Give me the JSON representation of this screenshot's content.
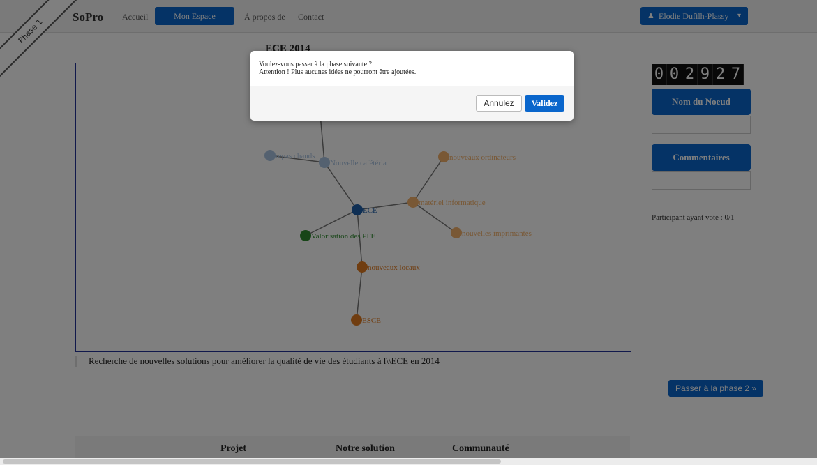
{
  "nav": {
    "brand": "SoPro",
    "links": [
      "Accueil",
      "Mon Espace",
      "À propos de",
      "Contact"
    ],
    "user": "Elodie Dufilh-Plassy",
    "user_icon": "user-icon",
    "caret_icon": "caret-down-icon",
    "accent": "#0a66cc"
  },
  "ribbon": "Phase 1",
  "title": "ECE 2014",
  "graph": {
    "nodes": [
      {
        "id": "ece",
        "label": "ECE",
        "color": "#1f5fa8"
      },
      {
        "id": "cafet",
        "label": "Nouvelle cafétéria",
        "color": "#a9c3e0"
      },
      {
        "id": "repas",
        "label": "repas chauds",
        "color": "#a9c3e0"
      },
      {
        "id": "pfe",
        "label": "Valorisation des PFE",
        "color": "#2e8b2e"
      },
      {
        "id": "materiel",
        "label": "matériel informatique",
        "color": "#f2b06a"
      },
      {
        "id": "ordis",
        "label": "nouveaux ordinateurs",
        "color": "#f2b06a"
      },
      {
        "id": "imprimantes",
        "label": "nouvelles imprimantes",
        "color": "#f2b06a"
      },
      {
        "id": "locaux",
        "label": "nouveaux locaux",
        "color": "#e07b20"
      },
      {
        "id": "esce",
        "label": "ESCE",
        "color": "#e07b20"
      }
    ],
    "edges": [
      [
        "ece",
        "cafet"
      ],
      [
        "cafet",
        "repas"
      ],
      [
        "cafet",
        "top"
      ],
      [
        "ece",
        "pfe"
      ],
      [
        "ece",
        "materiel"
      ],
      [
        "materiel",
        "ordis"
      ],
      [
        "materiel",
        "imprimantes"
      ],
      [
        "ece",
        "locaux"
      ],
      [
        "locaux",
        "esce"
      ]
    ]
  },
  "description": "Recherche de nouvelles solutions pour améliorer la qualité de vie des étudiants à l\\\\ECE en 2014",
  "timer": [
    "0",
    "0",
    "2",
    "9",
    "2",
    "7"
  ],
  "side": {
    "node_name_button": "Nom du Noeud",
    "comments_button": "Commentaires",
    "voters": "Participant ayant voté : 0/1"
  },
  "next_phase": "Passer à la phase 2 »",
  "footer": [
    "Projet",
    "Notre solution",
    "Communauté"
  ],
  "modal": {
    "line1": "Voulez-vous passer à la phase suivante ?",
    "line2": "Attention ! Plus aucunes idées ne pourront être ajoutées.",
    "cancel": "Annulez",
    "validate": "Validez"
  }
}
